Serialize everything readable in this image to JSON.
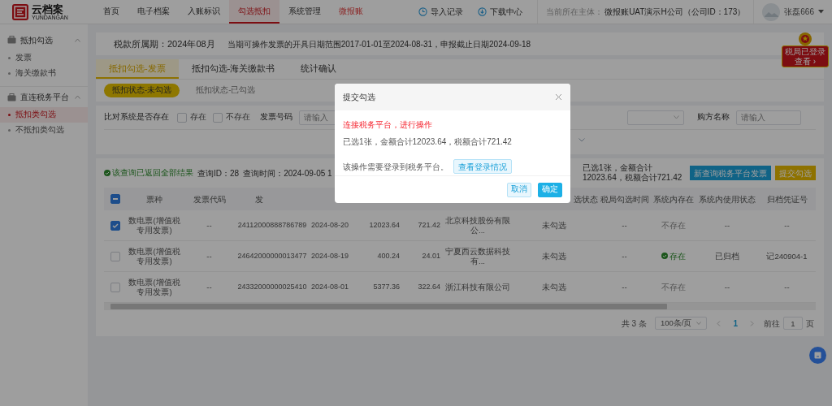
{
  "nav": {
    "logo_text": "云档案",
    "logo_sub": "YUNDANGAN",
    "items": [
      {
        "label": "首页",
        "selected": false,
        "kind": "plain"
      },
      {
        "label": "电子档案",
        "selected": false,
        "kind": "plain"
      },
      {
        "label": "入账标识",
        "selected": false,
        "kind": "plain"
      },
      {
        "label": "勾选抵扣",
        "selected": true,
        "kind": "plain"
      },
      {
        "label": "系统管理",
        "selected": false,
        "kind": "plain"
      },
      {
        "label": "微报账",
        "selected": false,
        "kind": "promo"
      }
    ],
    "links": [
      {
        "label": "导入记录",
        "kind": "clock"
      },
      {
        "label": "下载中心",
        "kind": "download"
      }
    ],
    "entity_label": "当前所在主体：",
    "entity": "微报账UAT演示H公司（公司ID：173）",
    "user": "张磊666"
  },
  "sidebar": [
    {
      "title": "抵扣勾选",
      "expanded": true,
      "items": [
        {
          "label": "发票",
          "selected": false
        },
        {
          "label": "海关缴款书",
          "selected": false
        }
      ]
    },
    {
      "title": "直连税务平台",
      "expanded": true,
      "items": [
        {
          "label": "抵扣类勾选",
          "selected": true
        },
        {
          "label": "不抵扣类勾选",
          "selected": false
        }
      ]
    }
  ],
  "period": {
    "label": "税款所属期：2024年08月",
    "info": "当期可操作发票的开具日期范围2017-01-01至2024-08-31，申报截止日期2024-09-18"
  },
  "login_badge": {
    "line_1": "税局已登录",
    "line_2": "查看 ›"
  },
  "tabs": [
    {
      "label": "抵扣勾选-发票",
      "selected": true
    },
    {
      "label": "抵扣勾选-海关缴款书",
      "selected": false
    },
    {
      "label": "统计确认",
      "selected": false
    }
  ],
  "subtabs": [
    {
      "label": "抵扣状态-未勾选",
      "selected": true
    },
    {
      "label": "抵扣状态-已勾选",
      "selected": false
    }
  ],
  "filters": {
    "compare_label": "比对系统是否存在",
    "options": [
      {
        "label": "存在",
        "checked": false
      },
      {
        "label": "不存在",
        "checked": false
      }
    ],
    "invoice_no": {
      "label": "发票号码",
      "placeholder": "请输入"
    },
    "buyer": {
      "label": "购方名称",
      "placeholder": "请输入"
    }
  },
  "result": {
    "status": "该查询已返回全部结果",
    "query_id": "查询ID：28",
    "query_time": "查询时间：2024-09-05 1",
    "summary": "已选1张，金额合计12023.64，税额合计721.42",
    "buttons": [
      {
        "label": "新查询税务平台发票",
        "kind": "query"
      },
      {
        "label": "提交勾选",
        "kind": "submit"
      }
    ]
  },
  "table": {
    "select_all_indeterminate": true,
    "columns": [
      {
        "label": "票种"
      },
      {
        "label": "发票代码"
      },
      {
        "label": "发"
      },
      null,
      null,
      null,
      null,
      {
        "label": "选状态"
      },
      {
        "label": "税局勾选时间"
      },
      {
        "label": "系统内存在"
      },
      {
        "label": "系统内使用状态"
      },
      {
        "label": "归档凭证号"
      }
    ],
    "rows": [
      {
        "checked": true,
        "in_system": false,
        "cells": [
          "数电票(增值税专用发票)",
          "--",
          "24112000888786789",
          "2024-08-20",
          "12023.64",
          "721.42",
          "北京科技股份有限公...",
          "未勾选",
          "--",
          "不存在",
          "--",
          "--"
        ]
      },
      {
        "checked": false,
        "in_system": true,
        "cells": [
          "数电票(增值税专用发票)",
          "--",
          "24642000000013477",
          "2024-08-19",
          "400.24",
          "24.01",
          "宁夏西云数据科技有...",
          "未勾选",
          "--",
          "存在",
          "已归档",
          "记240904-1"
        ]
      },
      {
        "checked": false,
        "in_system": false,
        "cells": [
          "数电票(增值税专用发票)",
          "--",
          "24332000000025410",
          "2024-08-01",
          "5377.36",
          "322.64",
          "浙江科技有限公司",
          "未勾选",
          "--",
          "不存在",
          "--",
          "--"
        ]
      }
    ]
  },
  "pagination": {
    "total": "共 3 条",
    "page_size": "100条/页",
    "pages": [
      {
        "label": "1",
        "selected": true
      }
    ],
    "goto_label": "前往",
    "goto_value": "1",
    "suffix": "页"
  },
  "modal": {
    "title": "提交勾选",
    "alert": "连接税务平台，进行操作",
    "summary": "已选1张，金额合计12023.64，税额合计721.42",
    "note": "该操作需要登录到税务平台。",
    "link_button": "查看登录情况",
    "buttons": [
      {
        "label": "取消",
        "kind": "secondary"
      },
      {
        "label": "确定",
        "kind": "primary"
      }
    ]
  }
}
